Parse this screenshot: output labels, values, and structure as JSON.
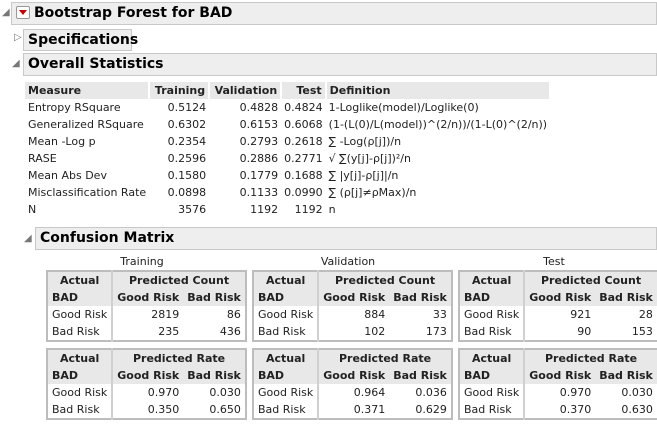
{
  "title": "Bootstrap Forest for BAD",
  "specifications": "Specifications",
  "overall": {
    "title": "Overall Statistics",
    "headers": [
      "Measure",
      "Training",
      "Validation",
      "Test",
      "Definition"
    ],
    "rows": [
      [
        "Entropy RSquare",
        "0.5124",
        "0.4828",
        "0.4824",
        "1-Loglike(model)/Loglike(0)"
      ],
      [
        "Generalized RSquare",
        "0.6302",
        "0.6153",
        "0.6068",
        "(1-(L(0)/L(model))^(2/n))/(1-L(0)^(2/n))"
      ],
      [
        "Mean -Log p",
        "0.2354",
        "0.2793",
        "0.2618",
        "∑ -Log(ρ[j])/n"
      ],
      [
        "RASE",
        "0.2596",
        "0.2886",
        "0.2771",
        "√ ∑(y[j]-ρ[j])²/n"
      ],
      [
        "Mean Abs Dev",
        "0.1580",
        "0.1779",
        "0.1688",
        "∑ |y[j]-ρ[j]|/n"
      ],
      [
        "Misclassification Rate",
        "0.0898",
        "0.1133",
        "0.0990",
        "∑ (ρ[j]≠ρMax)/n"
      ],
      [
        "N",
        "3576",
        "1192",
        "1192",
        "n"
      ]
    ]
  },
  "confusion": {
    "title": "Confusion Matrix",
    "actual": "Actual",
    "bad": "BAD",
    "count": "Predicted Count",
    "rate": "Predicted Rate",
    "cols": [
      "Good Risk",
      "Bad Risk"
    ],
    "sets": [
      {
        "name": "Training",
        "count": [
          [
            "Good Risk",
            "2819",
            "86"
          ],
          [
            "Bad Risk",
            "235",
            "436"
          ]
        ],
        "rate": [
          [
            "Good Risk",
            "0.970",
            "0.030"
          ],
          [
            "Bad Risk",
            "0.350",
            "0.650"
          ]
        ]
      },
      {
        "name": "Validation",
        "count": [
          [
            "Good Risk",
            "884",
            "33"
          ],
          [
            "Bad Risk",
            "102",
            "173"
          ]
        ],
        "rate": [
          [
            "Good Risk",
            "0.964",
            "0.036"
          ],
          [
            "Bad Risk",
            "0.371",
            "0.629"
          ]
        ]
      },
      {
        "name": "Test",
        "count": [
          [
            "Good Risk",
            "921",
            "28"
          ],
          [
            "Bad Risk",
            "90",
            "153"
          ]
        ],
        "rate": [
          [
            "Good Risk",
            "0.970",
            "0.030"
          ],
          [
            "Bad Risk",
            "0.370",
            "0.630"
          ]
        ]
      }
    ]
  }
}
